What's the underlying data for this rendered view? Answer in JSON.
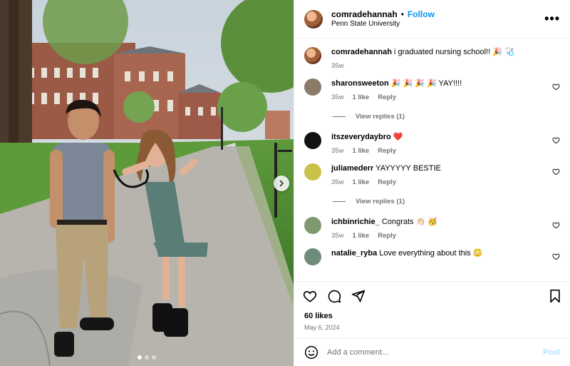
{
  "header": {
    "username": "comradehannah",
    "separator": "•",
    "follow_label": "Follow",
    "location": "Penn State University",
    "more_icon": "more-dots-icon",
    "more_label": "•••"
  },
  "caption": {
    "username": "comradehannah",
    "text": "i graduated nursing school!! 🎉 🩺",
    "time": "35w"
  },
  "comments": [
    {
      "username": "sharonsweeton",
      "text": "🎉 🎉 🎉 🎉 YAY!!!!",
      "time": "35w",
      "likes": "1 like",
      "reply": "Reply",
      "replies": "View replies (1)",
      "avatar_color": "#8a7a6a"
    },
    {
      "username": "itszeverydaybro",
      "text": "❤️",
      "time": "35w",
      "likes": "1 like",
      "reply": "Reply",
      "avatar_color": "#111111"
    },
    {
      "username": "juliamederr",
      "text": "YAYYYYY BESTIE",
      "time": "35w",
      "likes": "1 like",
      "reply": "Reply",
      "replies": "View replies (1)",
      "avatar_color": "#c9c14a"
    },
    {
      "username": "ichbinrichie_",
      "text": "Congrats 👏🏻 🥳",
      "time": "35w",
      "likes": "1 like",
      "reply": "Reply",
      "avatar_color": "#7f9a6e"
    },
    {
      "username": "natalie_ryba",
      "text": "Love everything about this 😳",
      "avatar_color": "#6f8b7a"
    }
  ],
  "actions": {
    "like_icon": "heart-icon",
    "comment_icon": "comment-icon",
    "share_icon": "share-icon",
    "save_icon": "bookmark-icon"
  },
  "likes": "60 likes",
  "date": "May 6, 2024",
  "add_comment": {
    "placeholder": "Add a comment...",
    "post_label": "Post",
    "emoji_icon": "smiley-icon"
  },
  "carousel": {
    "count": 3,
    "active": 0
  },
  "colors": {
    "accent": "#0095f6",
    "muted": "#737373",
    "post_disabled": "#b2dffc",
    "heart_red": "#ff3040"
  }
}
